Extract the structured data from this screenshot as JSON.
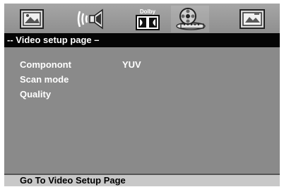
{
  "toolbar": {
    "tabs": [
      {
        "icon": "general-setup-icon"
      },
      {
        "icon": "audio-speaker-icon"
      },
      {
        "icon": "dolby-icon",
        "label": "Dolby"
      },
      {
        "icon": "video-setup-icon"
      },
      {
        "icon": "preference-icon"
      }
    ]
  },
  "page": {
    "title": "-- Video setup page –"
  },
  "menu": {
    "items": [
      {
        "label": "Componont",
        "value": "YUV"
      },
      {
        "label": "Scan mode",
        "value": ""
      },
      {
        "label": "Quality",
        "value": ""
      }
    ]
  },
  "status": {
    "text": "Go To Video Setup Page"
  }
}
